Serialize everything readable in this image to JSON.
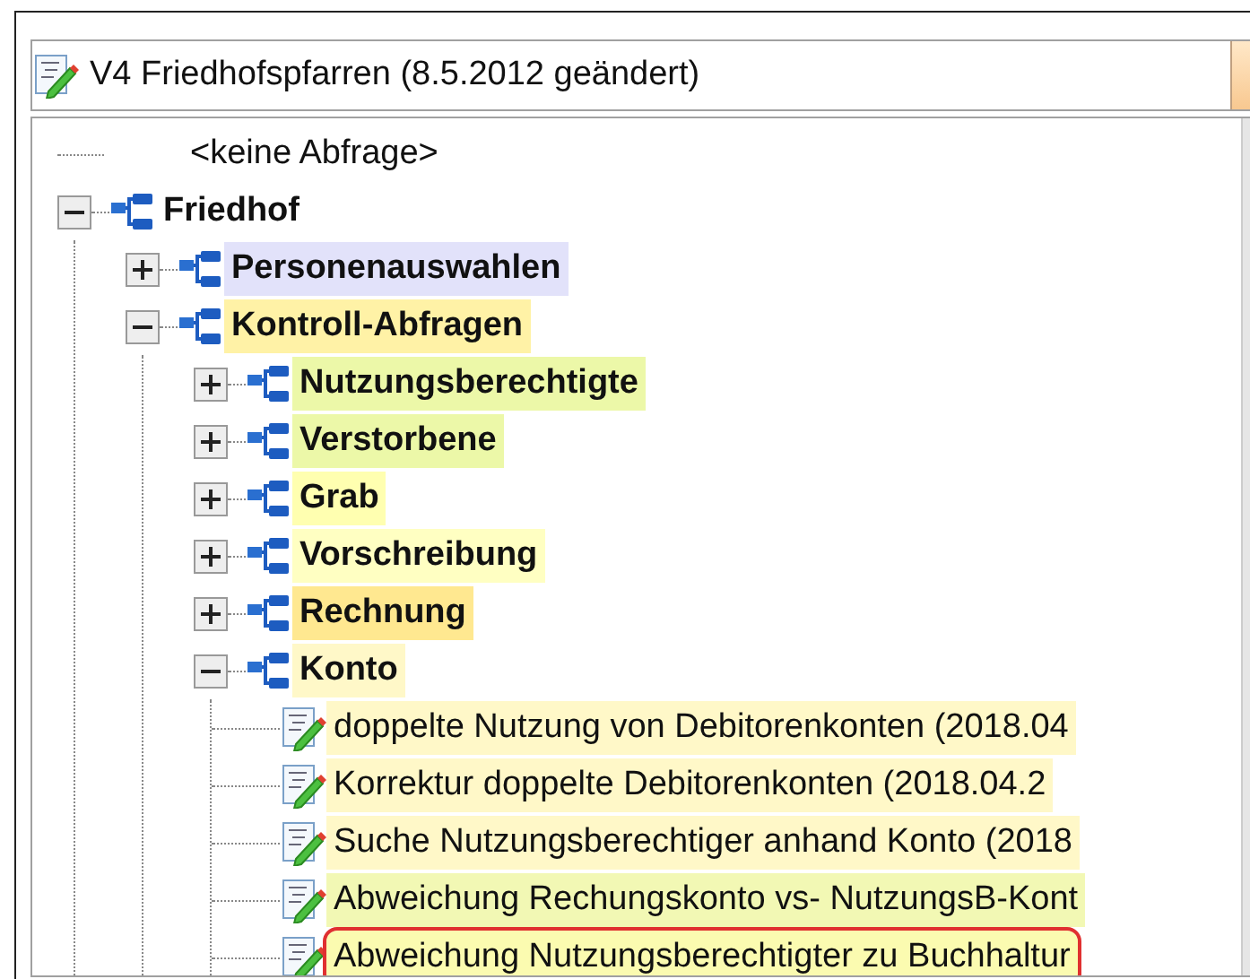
{
  "combo": {
    "text": "V4 Friedhofspfarren (8.5.2012 geändert)"
  },
  "tree": [
    {
      "kind": "none",
      "label": "<keine Abfrage>"
    },
    {
      "kind": "group",
      "label": "Friedhof",
      "expanded": true,
      "children": [
        {
          "kind": "group",
          "label": "Personenauswahlen",
          "expanded": false,
          "color": "#e2e2fa"
        },
        {
          "kind": "group",
          "label": "Kontroll-Abfragen",
          "expanded": true,
          "color": "#fff2a6",
          "children": [
            {
              "kind": "group",
              "label": "Nutzungsberechtigte",
              "expanded": false,
              "color": "#ecf8a8"
            },
            {
              "kind": "group",
              "label": "Verstorbene",
              "expanded": false,
              "color": "#ecf8a8"
            },
            {
              "kind": "group",
              "label": "Grab",
              "expanded": false,
              "color": "#ffffb0"
            },
            {
              "kind": "group",
              "label": "Vorschreibung",
              "expanded": false,
              "color": "#ffffc2"
            },
            {
              "kind": "group",
              "label": "Rechnung",
              "expanded": false,
              "color": "#ffe890"
            },
            {
              "kind": "group",
              "label": "Konto",
              "expanded": true,
              "color": "#fff8c8",
              "children": [
                {
                  "kind": "query",
                  "label": "doppelte Nutzung von Debitorenkonten (2018.04",
                  "color": "#fff8c8",
                  "marked": false
                },
                {
                  "kind": "query",
                  "label": "Korrektur doppelte Debitorenkonten  (2018.04.2",
                  "color": "#fff8c8",
                  "marked": false
                },
                {
                  "kind": "query",
                  "label": "Suche Nutzungsberechtiger anhand Konto (2018",
                  "color": "#fff8c8",
                  "marked": false
                },
                {
                  "kind": "query",
                  "label": "Abweichung Rechungskonto vs- NutzungsB-Kont",
                  "color": "#f2f8b4",
                  "marked": false
                },
                {
                  "kind": "query",
                  "label": "Abweichung Nutzungsberechtigter zu Buchhaltur",
                  "color": "#fbfbb0",
                  "marked": true
                }
              ]
            }
          ]
        }
      ]
    }
  ]
}
